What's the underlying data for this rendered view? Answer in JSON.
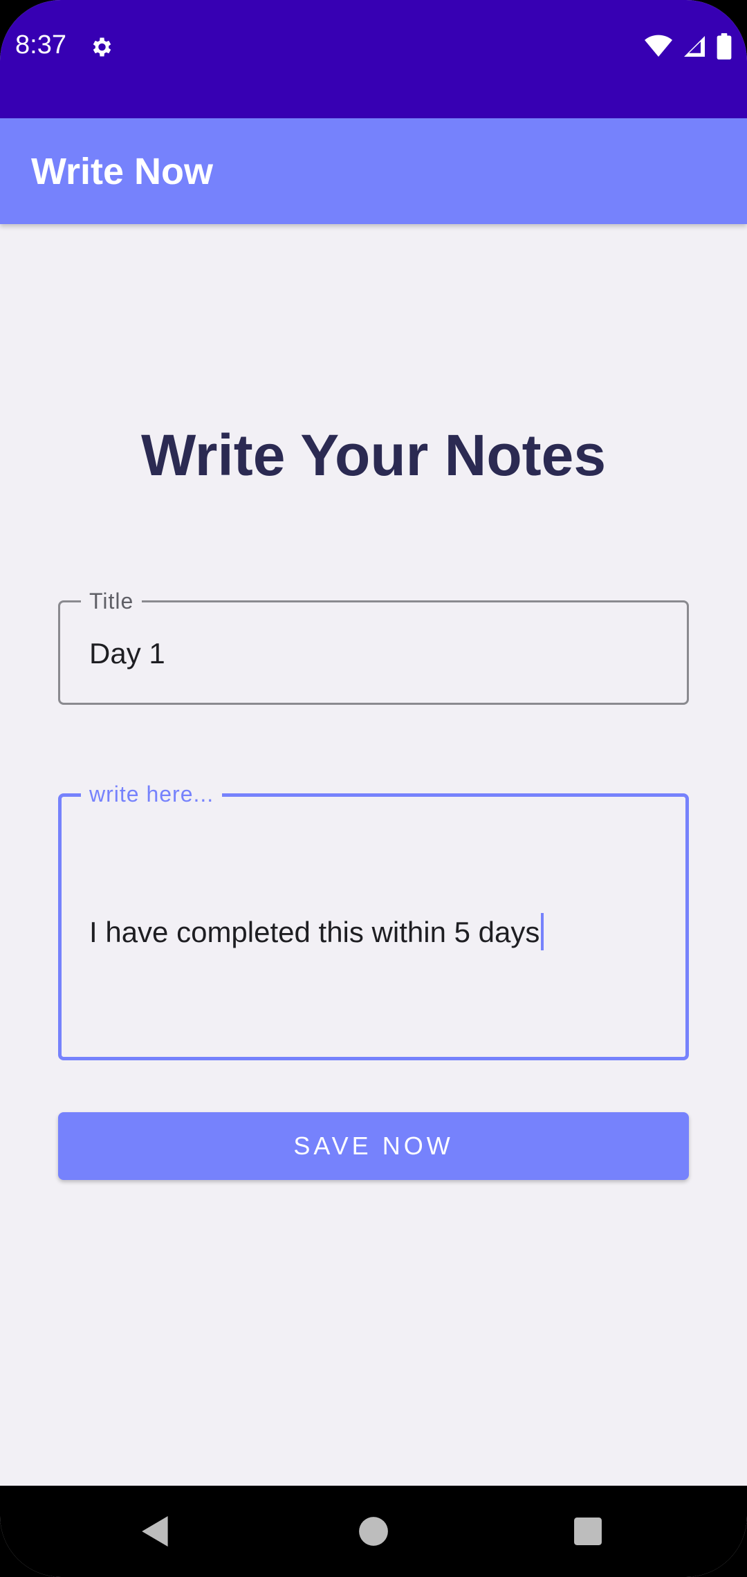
{
  "status_bar": {
    "time": "8:37",
    "icons": [
      "gear-icon",
      "wifi-icon",
      "cellular-signal-icon",
      "battery-icon"
    ],
    "background_color": "#3700b3"
  },
  "app_bar": {
    "title": "Write Now",
    "background_color": "#7682fc"
  },
  "main": {
    "heading": "Write Your Notes",
    "title_field": {
      "label": "Title",
      "value": "Day 1"
    },
    "notes_field": {
      "label": "write here...",
      "value": "I have completed this within 5 days",
      "focused": true
    },
    "save_button": {
      "label": "SAVE NOW"
    }
  },
  "nav_bar": {
    "buttons": [
      "back-icon",
      "home-icon",
      "recents-icon"
    ]
  },
  "colors": {
    "accent": "#7682fc",
    "heading": "#2b2a52",
    "screen_background": "#f2f0f5"
  }
}
